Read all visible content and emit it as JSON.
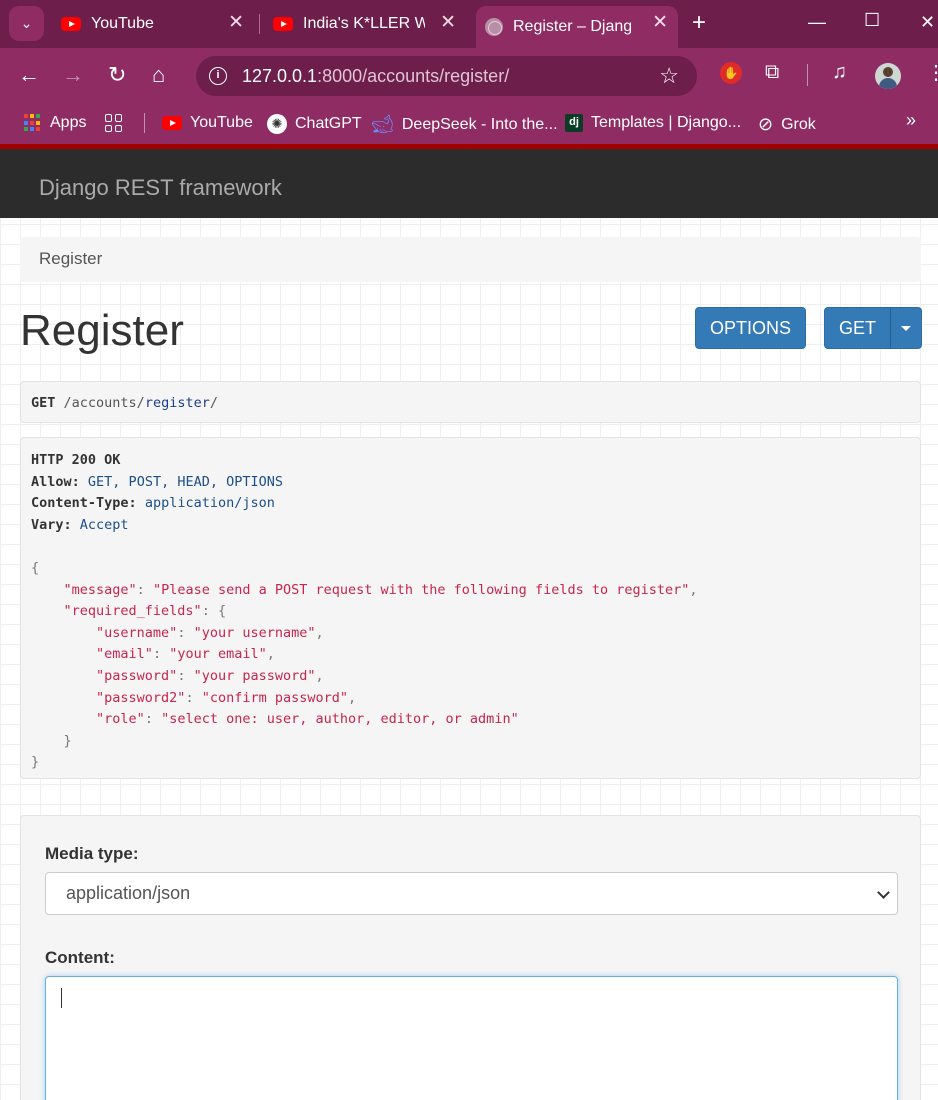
{
  "browser": {
    "tabs": [
      {
        "title": "YouTube",
        "favicon": "youtube-icon"
      },
      {
        "title": "India's K*LLER War",
        "favicon": "youtube-icon"
      },
      {
        "title": "Register – Django",
        "favicon": "globe-icon",
        "active": true
      }
    ],
    "address_bar": {
      "host": "127.0.0.1",
      "rest": ":8000/accounts/register/"
    },
    "bookmarks": [
      {
        "label": "Apps",
        "icon": "apps-icon"
      },
      {
        "label": "YouTube",
        "icon": "youtube-icon"
      },
      {
        "label": "ChatGPT",
        "icon": "chatgpt-icon"
      },
      {
        "label": "DeepSeek - Into the...",
        "icon": "deepseek-icon"
      },
      {
        "label": "Templates | Django...",
        "icon": "django-icon"
      },
      {
        "label": "Grok",
        "icon": "grok-icon"
      }
    ]
  },
  "page": {
    "brand": "Django REST framework",
    "breadcrumb": "Register",
    "title": "Register",
    "buttons": {
      "options": "OPTIONS",
      "get": "GET"
    },
    "request": {
      "method": "GET",
      "path_prefix": "/accounts/",
      "path_link": "register",
      "path_suffix": "/"
    },
    "response": {
      "status": "HTTP 200 OK",
      "headers": [
        {
          "name": "Allow:",
          "value": "GET, POST, HEAD, OPTIONS"
        },
        {
          "name": "Content-Type:",
          "value": "application/json"
        },
        {
          "name": "Vary:",
          "value": "Accept"
        }
      ],
      "body": {
        "message": "Please send a POST request with the following fields to register",
        "required_fields": {
          "username": "your username",
          "email": "your email",
          "password": "your password",
          "password2": "confirm password",
          "role": "select one: user, author, editor, or admin"
        }
      }
    },
    "form": {
      "media_type_label": "Media type:",
      "media_type_value": "application/json",
      "content_label": "Content:",
      "content_value": ""
    }
  },
  "colors": {
    "tabstrip": "#6d1e4b",
    "toolbar": "#8e2c63",
    "navbar": "#2c2c2c",
    "accent_red": "#a30000",
    "button_primary": "#337ab7",
    "json_key": "#c7254e"
  }
}
